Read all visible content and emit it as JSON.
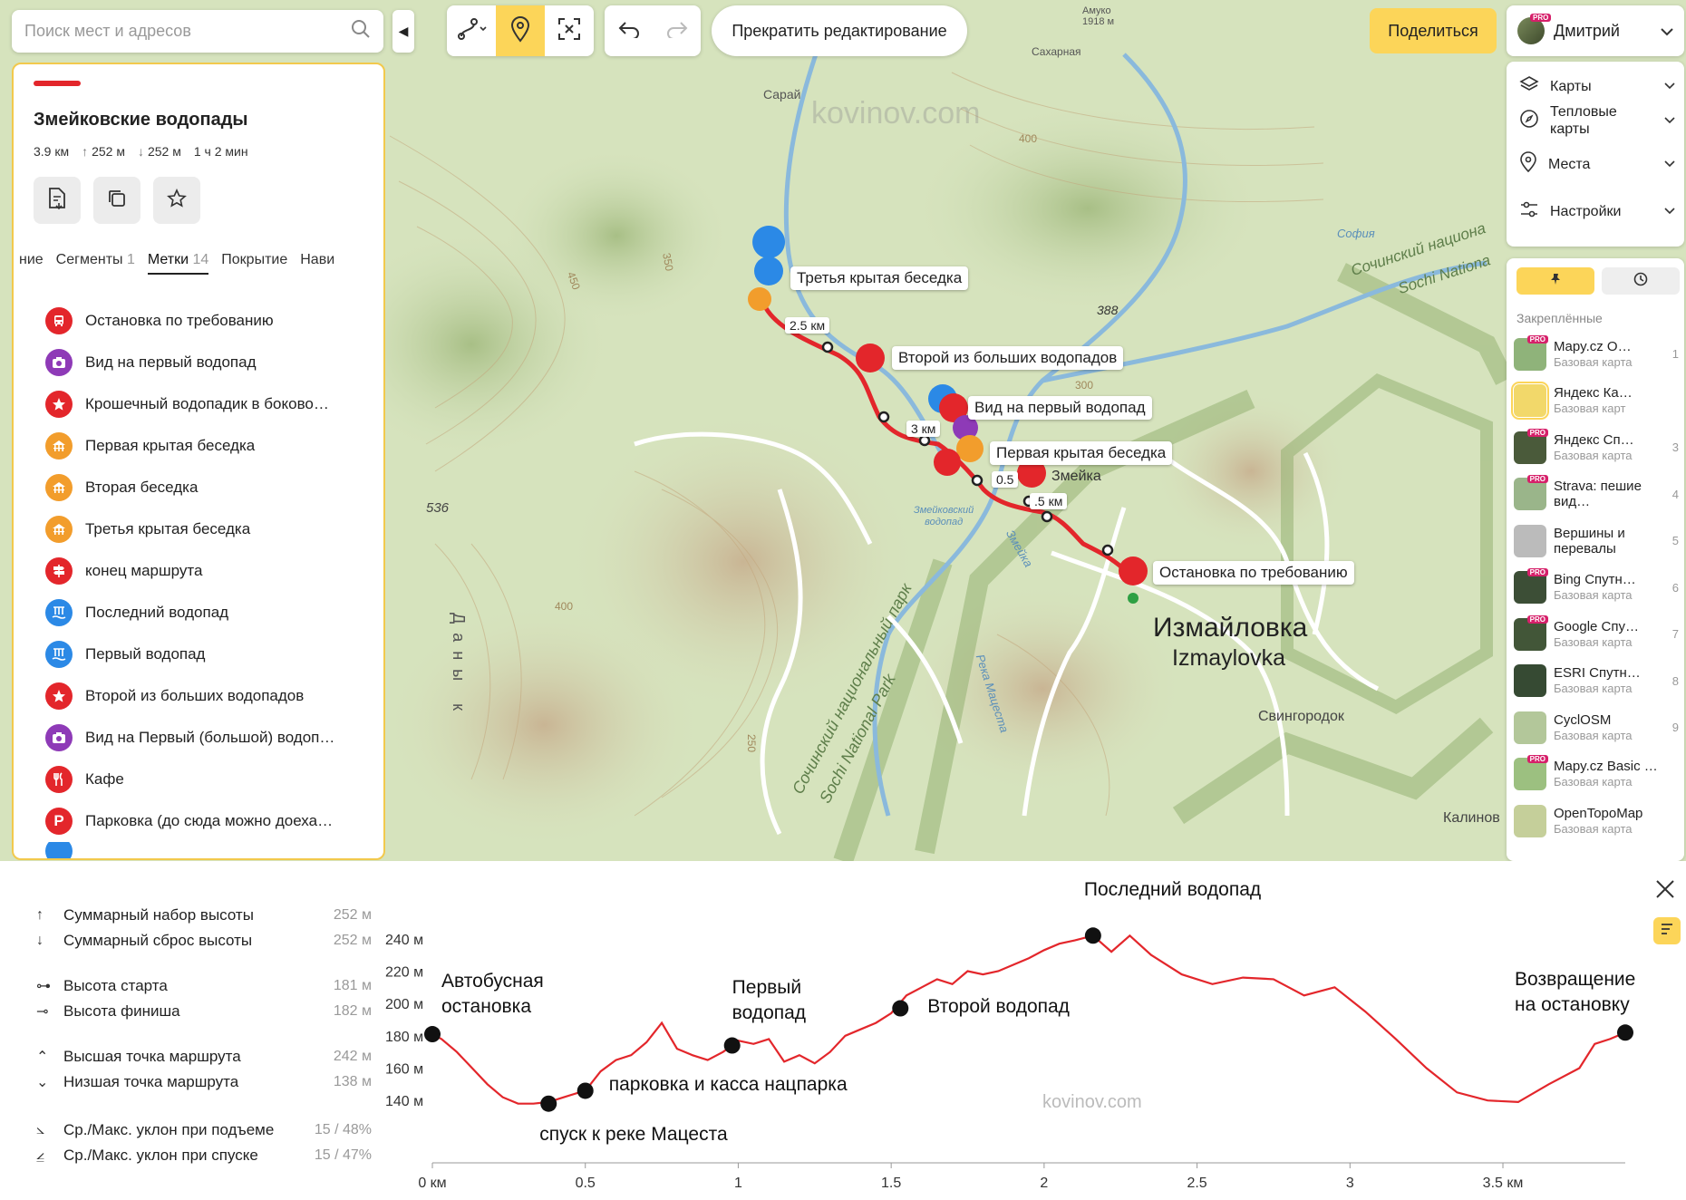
{
  "search": {
    "placeholder": "Поиск мест и адресов"
  },
  "toolbar": {
    "stop_editing_label": "Прекратить редактирование",
    "share_label": "Поделиться",
    "user_name": "Дмитрий",
    "pro_badge": "PRO"
  },
  "route": {
    "title": "Змейковские водопады",
    "distance": "3.9 км",
    "ascent": "252 м",
    "descent": "252 м",
    "duration": "1 ч 2 мин"
  },
  "tabs": [
    {
      "label": "ние",
      "count": ""
    },
    {
      "label": "Сегменты",
      "count": "1"
    },
    {
      "label": "Метки",
      "count": "14"
    },
    {
      "label": "Покрытие",
      "count": ""
    },
    {
      "label": "Нави",
      "count": ""
    }
  ],
  "waypoints": [
    {
      "label": "Остановка по требованию",
      "icon": "bus-icon",
      "color": "#e3262b"
    },
    {
      "label": "Вид на первый водопад",
      "icon": "camera-icon",
      "color": "#8e3ab7"
    },
    {
      "label": "Крошечный водопадик в боково…",
      "icon": "star-icon",
      "color": "#e3262b"
    },
    {
      "label": "Первая крытая беседка",
      "icon": "gazebo-icon",
      "color": "#f29d2c"
    },
    {
      "label": "Вторая беседка",
      "icon": "gazebo-icon",
      "color": "#f29d2c"
    },
    {
      "label": "Третья крытая беседка",
      "icon": "gazebo-icon",
      "color": "#f29d2c"
    },
    {
      "label": "конец маршрута",
      "icon": "signpost-icon",
      "color": "#e3262b"
    },
    {
      "label": "Последний водопад",
      "icon": "waterfall-icon",
      "color": "#2b89e6"
    },
    {
      "label": "Первый водопад",
      "icon": "waterfall-icon",
      "color": "#2b89e6"
    },
    {
      "label": "Второй из больших водопадов",
      "icon": "star-icon",
      "color": "#e3262b"
    },
    {
      "label": "Вид на Первый (большой) водоп…",
      "icon": "camera-icon",
      "color": "#8e3ab7"
    },
    {
      "label": "Кафе",
      "icon": "cafe-icon",
      "color": "#e3262b"
    },
    {
      "label": "Парковка (до сюда можно доеха…",
      "icon": "parking-icon",
      "color": "#e3262b"
    }
  ],
  "layers": [
    {
      "label": "Карты",
      "icon": "layers-icon"
    },
    {
      "label": "Тепловые карты",
      "icon": "compass-icon"
    },
    {
      "label": "Места",
      "icon": "place-icon"
    },
    {
      "label": "Настройки",
      "icon": "settings-icon"
    }
  ],
  "basemaps_title": "Закреплённые",
  "basemaps": [
    {
      "name": "Mapy.cz O…",
      "sub": "Базовая карта",
      "num": "1",
      "pro": true,
      "color": "#8fb37a"
    },
    {
      "name": "Яндекс Ка…",
      "sub": "Базовая карт",
      "num": "",
      "pro": false,
      "color": "#f2d86a"
    },
    {
      "name": "Яндекс Сп…",
      "sub": "Базовая карта",
      "num": "3",
      "pro": true,
      "color": "#4a5a3a"
    },
    {
      "name": "Strava: пешие вид…",
      "sub": "",
      "num": "4",
      "pro": true,
      "color": "#9ab58a"
    },
    {
      "name": "Вершины и перевалы",
      "sub": "",
      "num": "5",
      "pro": false,
      "color": "#bbbbbb"
    },
    {
      "name": "Bing Спутн…",
      "sub": "Базовая карта",
      "num": "6",
      "pro": true,
      "color": "#3c4e36"
    },
    {
      "name": "Google Спу…",
      "sub": "Базовая карта",
      "num": "7",
      "pro": true,
      "color": "#425638"
    },
    {
      "name": "ESRI Спутн…",
      "sub": "Базовая карта",
      "num": "8",
      "pro": false,
      "color": "#364a33"
    },
    {
      "name": "CyclOSM",
      "sub": "Базовая карта",
      "num": "9",
      "pro": false,
      "color": "#b3c79a"
    },
    {
      "name": "Mapy.cz Basic …",
      "sub": "Базовая карта",
      "num": "",
      "pro": true,
      "color": "#9cc080"
    },
    {
      "name": "OpenTopoMap",
      "sub": "Базовая карта",
      "num": "",
      "pro": false,
      "color": "#c5cf9a"
    }
  ],
  "map_labels": {
    "amuko": "Амуко\n1918 м",
    "sakharnaya": "Сахарная",
    "saray": "Сарай",
    "watermark": "kovinov.com",
    "sofia": "София",
    "peak": "388",
    "park_ru": "Сочинский национа",
    "park_en": "Sochi Nationa",
    "park2_ru": "Сочинский национальный парк",
    "park2_en": "Sochi National Park",
    "izmaylovka_ru": "Измайловка",
    "izmaylovka_en": "Izmaylovka",
    "svingorodok": "Свингородок",
    "kalinov": "Калинов",
    "zmeyka": "Змейка",
    "zmeykovsky": "Змейковский\nводопад",
    "matsesta": "Река Мацеста",
    "zmeykarka": "Змейка",
    "elev_536": "536",
    "contour_450": "450",
    "contour_400": "400",
    "contour_350": "350",
    "contour_300": "300",
    "contour_250": "250",
    "dany": "Даны к",
    "callouts": [
      "Третья крытая беседка",
      "Второй из больших водопадов",
      "Вид на первый водопад",
      "Первая крытая беседка",
      "Остановка по требованию"
    ],
    "km_labels": [
      "2.5 км",
      "3 км",
      "0.5",
      ".5 км"
    ]
  },
  "profile_stats": [
    {
      "label": "Суммарный набор высоты",
      "value": "252 м",
      "icon": "arrow-up-icon"
    },
    {
      "label": "Суммарный сброс высоты",
      "value": "252 м",
      "icon": "arrow-down-icon"
    },
    {
      "label": "Высота старта",
      "value": "181 м",
      "icon": "start-icon"
    },
    {
      "label": "Высота финиша",
      "value": "182 м",
      "icon": "finish-icon"
    },
    {
      "label": "Высшая точка маршрута",
      "value": "242 м",
      "icon": "highpoint-icon"
    },
    {
      "label": "Низшая точка маршрута",
      "value": "138 м",
      "icon": "lowpoint-icon"
    },
    {
      "label": "Ср./Макс. уклон при подъеме",
      "value": "15 / 48%",
      "icon": "incline-up-icon"
    },
    {
      "label": "Ср./Макс. уклон при спуске",
      "value": "15 / 47%",
      "icon": "incline-down-icon"
    }
  ],
  "chart_data": {
    "type": "line",
    "xlabel": "",
    "ylabel": "",
    "xlim": [
      0,
      3.9
    ],
    "ylim": [
      130,
      250
    ],
    "x_ticks": [
      0,
      0.5,
      1,
      1.5,
      2,
      2.5,
      3,
      3.5
    ],
    "x_tick_labels": [
      "0 км",
      "0.5",
      "1",
      "1.5",
      "2",
      "2.5",
      "3",
      "3.5 км"
    ],
    "y_ticks": [
      140,
      160,
      180,
      200,
      220,
      240
    ],
    "y_tick_labels": [
      "140 м",
      "160 м",
      "180 м",
      "200 м",
      "220 м",
      "240 м"
    ],
    "color": "#e3262b",
    "watermark": "kovinov.com",
    "series": [
      {
        "x": [
          0,
          0.03,
          0.08,
          0.13,
          0.18,
          0.23,
          0.28,
          0.33,
          0.38,
          0.43,
          0.48,
          0.5,
          0.55,
          0.6,
          0.65,
          0.7,
          0.75,
          0.8,
          0.85,
          0.9,
          0.95,
          0.98,
          1.0,
          1.05,
          1.1,
          1.15,
          1.2,
          1.25,
          1.3,
          1.35,
          1.4,
          1.45,
          1.5,
          1.55,
          1.6,
          1.65,
          1.7,
          1.75,
          1.8,
          1.85,
          1.9,
          1.95,
          2.0,
          2.05,
          2.1,
          2.16,
          2.22,
          2.28,
          2.35,
          2.45,
          2.55,
          2.65,
          2.75,
          2.85,
          2.95,
          3.05,
          3.15,
          3.25,
          3.35,
          3.45,
          3.55,
          3.65,
          3.75,
          3.8,
          3.85,
          3.9
        ],
        "y": [
          181,
          178,
          170,
          160,
          150,
          142,
          138,
          138,
          139,
          142,
          145,
          146,
          158,
          165,
          168,
          176,
          188,
          172,
          168,
          165,
          170,
          174,
          177,
          175,
          178,
          164,
          168,
          163,
          170,
          180,
          184,
          188,
          194,
          205,
          210,
          215,
          212,
          220,
          218,
          220,
          224,
          228,
          233,
          237,
          239,
          242,
          232,
          242,
          230,
          218,
          212,
          216,
          215,
          205,
          210,
          195,
          178,
          160,
          145,
          140,
          139,
          150,
          160,
          175,
          178,
          182
        ]
      }
    ],
    "markers": [
      {
        "x": 0,
        "y": 181,
        "label": "Автобусная\nостановка"
      },
      {
        "x": 0.38,
        "y": 138,
        "label": "спуск к реке Мацеста"
      },
      {
        "x": 0.5,
        "y": 146,
        "label": "парковка и касса нацпарка"
      },
      {
        "x": 0.98,
        "y": 174,
        "label": "Первый\nводопад"
      },
      {
        "x": 1.53,
        "y": 197,
        "label": "Второй водопад"
      },
      {
        "x": 2.16,
        "y": 242,
        "label": "Последний водопад"
      },
      {
        "x": 3.9,
        "y": 182,
        "label": "Возвращение\nна остановку"
      }
    ]
  }
}
